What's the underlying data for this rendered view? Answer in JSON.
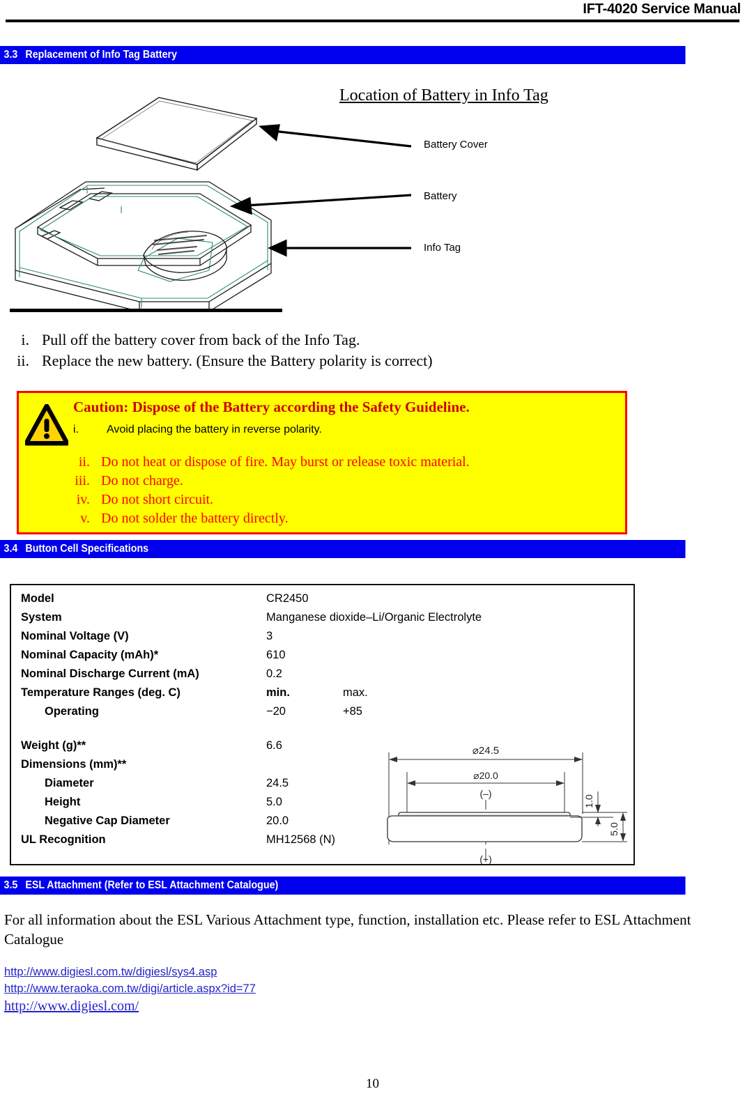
{
  "header": {
    "title": "IFT-4020 Service Manual"
  },
  "sections": {
    "s33": {
      "number": "3.3",
      "title": "Replacement of Info Tag Battery"
    },
    "s34": {
      "number": "3.4",
      "title": "Button Cell Specifications"
    },
    "s35": {
      "number": "3.5",
      "title": "ESL Attachment (Refer to ESL Attachment Catalogue)"
    }
  },
  "figure": {
    "title": "Location of Battery in Info Tag",
    "labels": {
      "cover": "Battery Cover",
      "battery": "Battery",
      "info_tag": "Info Tag"
    }
  },
  "steps": [
    {
      "num": "i.",
      "text": "Pull off the battery cover from back of the Info Tag."
    },
    {
      "num": "ii.",
      "text": "Replace the new battery. (Ensure the Battery polarity is correct)"
    }
  ],
  "caution": {
    "title": "Caution: Dispose of the Battery according the Safety Guideline.",
    "first_item": {
      "num": "i.",
      "text": "Avoid placing the battery in reverse polarity."
    },
    "items": [
      {
        "num": "ii.",
        "text": "Do not heat or dispose of fire. May burst or release toxic material."
      },
      {
        "num": "iii.",
        "text": "Do not charge."
      },
      {
        "num": "iv.",
        "text": "Do not short circuit."
      },
      {
        "num": "v.",
        "text": "Do not solder the battery directly."
      }
    ],
    "background_color": "#ffff00",
    "border_color": "#ff0000",
    "text_color": "#ff0000",
    "title_color": "#cc0000"
  },
  "spec_table": {
    "rows": [
      {
        "label": "Model",
        "value": "CR2450"
      },
      {
        "label": "System",
        "value": "Manganese dioxide–Li/Organic Electrolyte"
      },
      {
        "label": "Nominal Voltage (V)",
        "value": "3"
      },
      {
        "label": "Nominal Capacity (mAh)*",
        "value": "610"
      },
      {
        "label": "Nominal Discharge Current (mA)",
        "value": "0.2"
      },
      {
        "label": "Temperature Ranges (deg. C)",
        "value": "min.",
        "value2": "max.",
        "bold_values": true
      },
      {
        "label": "Operating",
        "value": "−20",
        "value2": "+85",
        "indent": true
      },
      {
        "label": "Weight (g)**",
        "value": "6.6"
      },
      {
        "label": "Dimensions (mm)**",
        "value": ""
      },
      {
        "label": "Diameter",
        "value": "24.5",
        "indent": true
      },
      {
        "label": "Height",
        "value": "5.0",
        "indent": true
      },
      {
        "label": "Negative Cap Diameter",
        "value": "20.0",
        "indent": true
      },
      {
        "label": "UL Recognition",
        "value": "MH12568 (N)"
      }
    ],
    "drawing": {
      "outer_diameter": "ø24.5",
      "inner_diameter": "ø20.0",
      "negative_marker": "(–)",
      "positive_marker": "(+)",
      "cap_height": "1.0",
      "total_height": "5.0"
    }
  },
  "esl": {
    "paragraph": "For all information about the ESL Various Attachment type, function, installation etc. Please refer to ESL Attachment Catalogue",
    "links": [
      {
        "url": "http://www.digiesl.com.tw/digiesl/sys4.asp",
        "style": "sans"
      },
      {
        "url": "http://www.teraoka.com.tw/digi/article.aspx?id=77",
        "style": "sans"
      },
      {
        "url": "http://www.digiesl.com/",
        "style": "serif"
      }
    ],
    "link_color": "#2222cc"
  },
  "footer": {
    "page_number": "10"
  },
  "theme": {
    "section_bar_color": "#0000ee",
    "section_bar_text": "#ffffff"
  }
}
